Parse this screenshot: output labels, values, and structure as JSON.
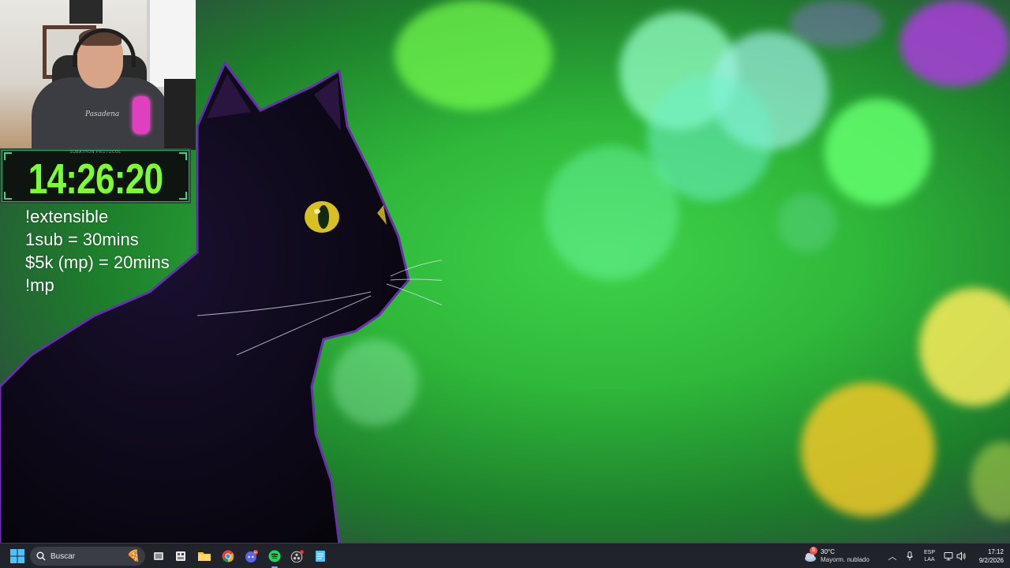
{
  "overlay": {
    "timer": {
      "caption": "SUBATHON PROTOCOL",
      "value": "14:26:20"
    },
    "info_lines": [
      "!extensible",
      "1sub = 30mins",
      "$5k (mp) = 20mins",
      "!mp"
    ],
    "webcam": {
      "shirt_text": "Pasadena"
    }
  },
  "taskbar": {
    "search": {
      "placeholder": "Buscar"
    },
    "apps": [
      {
        "name": "task-view",
        "icon": "task-view-icon"
      },
      {
        "name": "widgets",
        "icon": "widgets-icon"
      },
      {
        "name": "file-explorer",
        "icon": "folder-icon"
      },
      {
        "name": "chrome",
        "icon": "chrome-icon"
      },
      {
        "name": "discord",
        "icon": "discord-icon",
        "badge": "9+"
      },
      {
        "name": "spotify",
        "icon": "spotify-icon",
        "active": true
      },
      {
        "name": "obs",
        "icon": "obs-icon",
        "recording": true
      },
      {
        "name": "notepad",
        "icon": "notepad-icon"
      }
    ],
    "weather": {
      "badge": "5",
      "temperature": "30°C",
      "description": "Mayorm. nublado"
    },
    "tray": {
      "language_top": "ESP",
      "language_bottom": "LAA"
    },
    "clock": {
      "time": "17:12",
      "date": "9/2/2026"
    }
  },
  "colors": {
    "timer_text": "#7dff2f",
    "taskbar_bg": "#20232a",
    "wallpaper_green": "#2fb83a"
  }
}
